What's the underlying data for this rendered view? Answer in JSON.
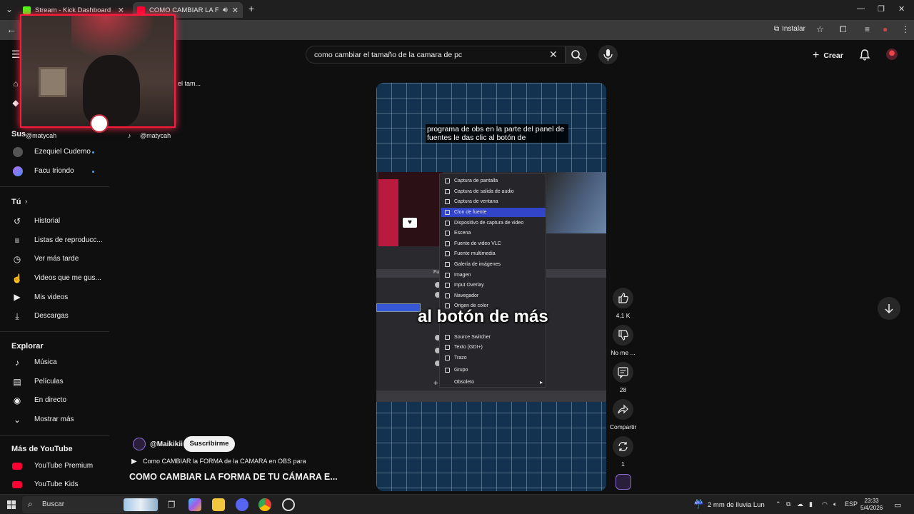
{
  "browser": {
    "tabs": [
      {
        "title": "Stream - Kick Dashboard",
        "favicon_color": "#53fc18"
      },
      {
        "title": "COMO CAMBIAR LA FORMA",
        "favicon_color": "#ff0033"
      }
    ],
    "new_tab": "+",
    "install_label": "Instalar"
  },
  "youtube": {
    "search_query": "como cambiar el tamaño de la camara de pc",
    "create_label": "Crear"
  },
  "sidebar": {
    "subs_partial": "Sus",
    "subscriptions": [
      {
        "name": "Ezequiel Cudemo"
      },
      {
        "name": "Facu Iriondo"
      }
    ],
    "you_header": "Tú",
    "you_items": [
      {
        "label": "Historial",
        "icon": "history-icon"
      },
      {
        "label": "Listas de reproducc...",
        "icon": "playlist-icon"
      },
      {
        "label": "Ver más tarde",
        "icon": "clock-icon"
      },
      {
        "label": "Videos que me gus...",
        "icon": "thumb-up-icon"
      },
      {
        "label": "Mis videos",
        "icon": "play-square-icon"
      },
      {
        "label": "Descargas",
        "icon": "download-icon"
      }
    ],
    "explore_header": "Explorar",
    "explore_items": [
      {
        "label": "Música",
        "icon": "music-icon"
      },
      {
        "label": "Películas",
        "icon": "movie-icon"
      },
      {
        "label": "En directo",
        "icon": "live-icon"
      },
      {
        "label": "Mostrar más",
        "icon": "chevron-down-icon"
      }
    ],
    "more_header": "Más de YouTube",
    "more_items": [
      {
        "label": "YouTube Premium"
      },
      {
        "label": "YouTube Kids"
      }
    ],
    "partial_text": "el tam..."
  },
  "overlay": {
    "handle_left": "@matycah",
    "handle_right": "@matycah"
  },
  "video": {
    "caption_top": "programa de obs en la parte del panel de fuentes le das clic al botón de",
    "caption_big": "al botón de más",
    "menu_items": [
      {
        "label": "Captura de pantalla"
      },
      {
        "label": "Captura de salida de audio"
      },
      {
        "label": "Captura de ventana"
      },
      {
        "label": "Clon de fuente",
        "selected": true
      },
      {
        "label": "Dispositivo de captura de video"
      },
      {
        "label": "Escena"
      },
      {
        "label": "Fuente de video VLC"
      },
      {
        "label": "Fuente multimedia"
      },
      {
        "label": "Galería de imágenes"
      },
      {
        "label": "Imagen"
      },
      {
        "label": "Input Overlay"
      },
      {
        "label": "Navegador"
      },
      {
        "label": "Origen de color"
      },
      {
        "label": "Source Switcher"
      },
      {
        "label": "Texto (GDI+)"
      },
      {
        "label": "Trazo"
      },
      {
        "label": "Grupo"
      },
      {
        "label": "Obsoleto",
        "submenu": true
      }
    ],
    "panel_label": "Fue"
  },
  "actions": {
    "likes": "4,1 K",
    "dislike": "No me ...",
    "comments": "28",
    "share": "Compartir",
    "remix": "1"
  },
  "info": {
    "channel": "@Maikikii",
    "subscribe": "Suscribirme",
    "subtitle": "Como CAMBIAR la FORMA de la CAMARA en OBS para",
    "title": "COMO CAMBIAR LA FORMA DE TU CÁMARA E..."
  },
  "taskbar": {
    "search_label": "Buscar",
    "weather": "2 mm de lluvia Lun",
    "lang": "ESP",
    "time": "23:33",
    "date": "5/4/2026"
  }
}
